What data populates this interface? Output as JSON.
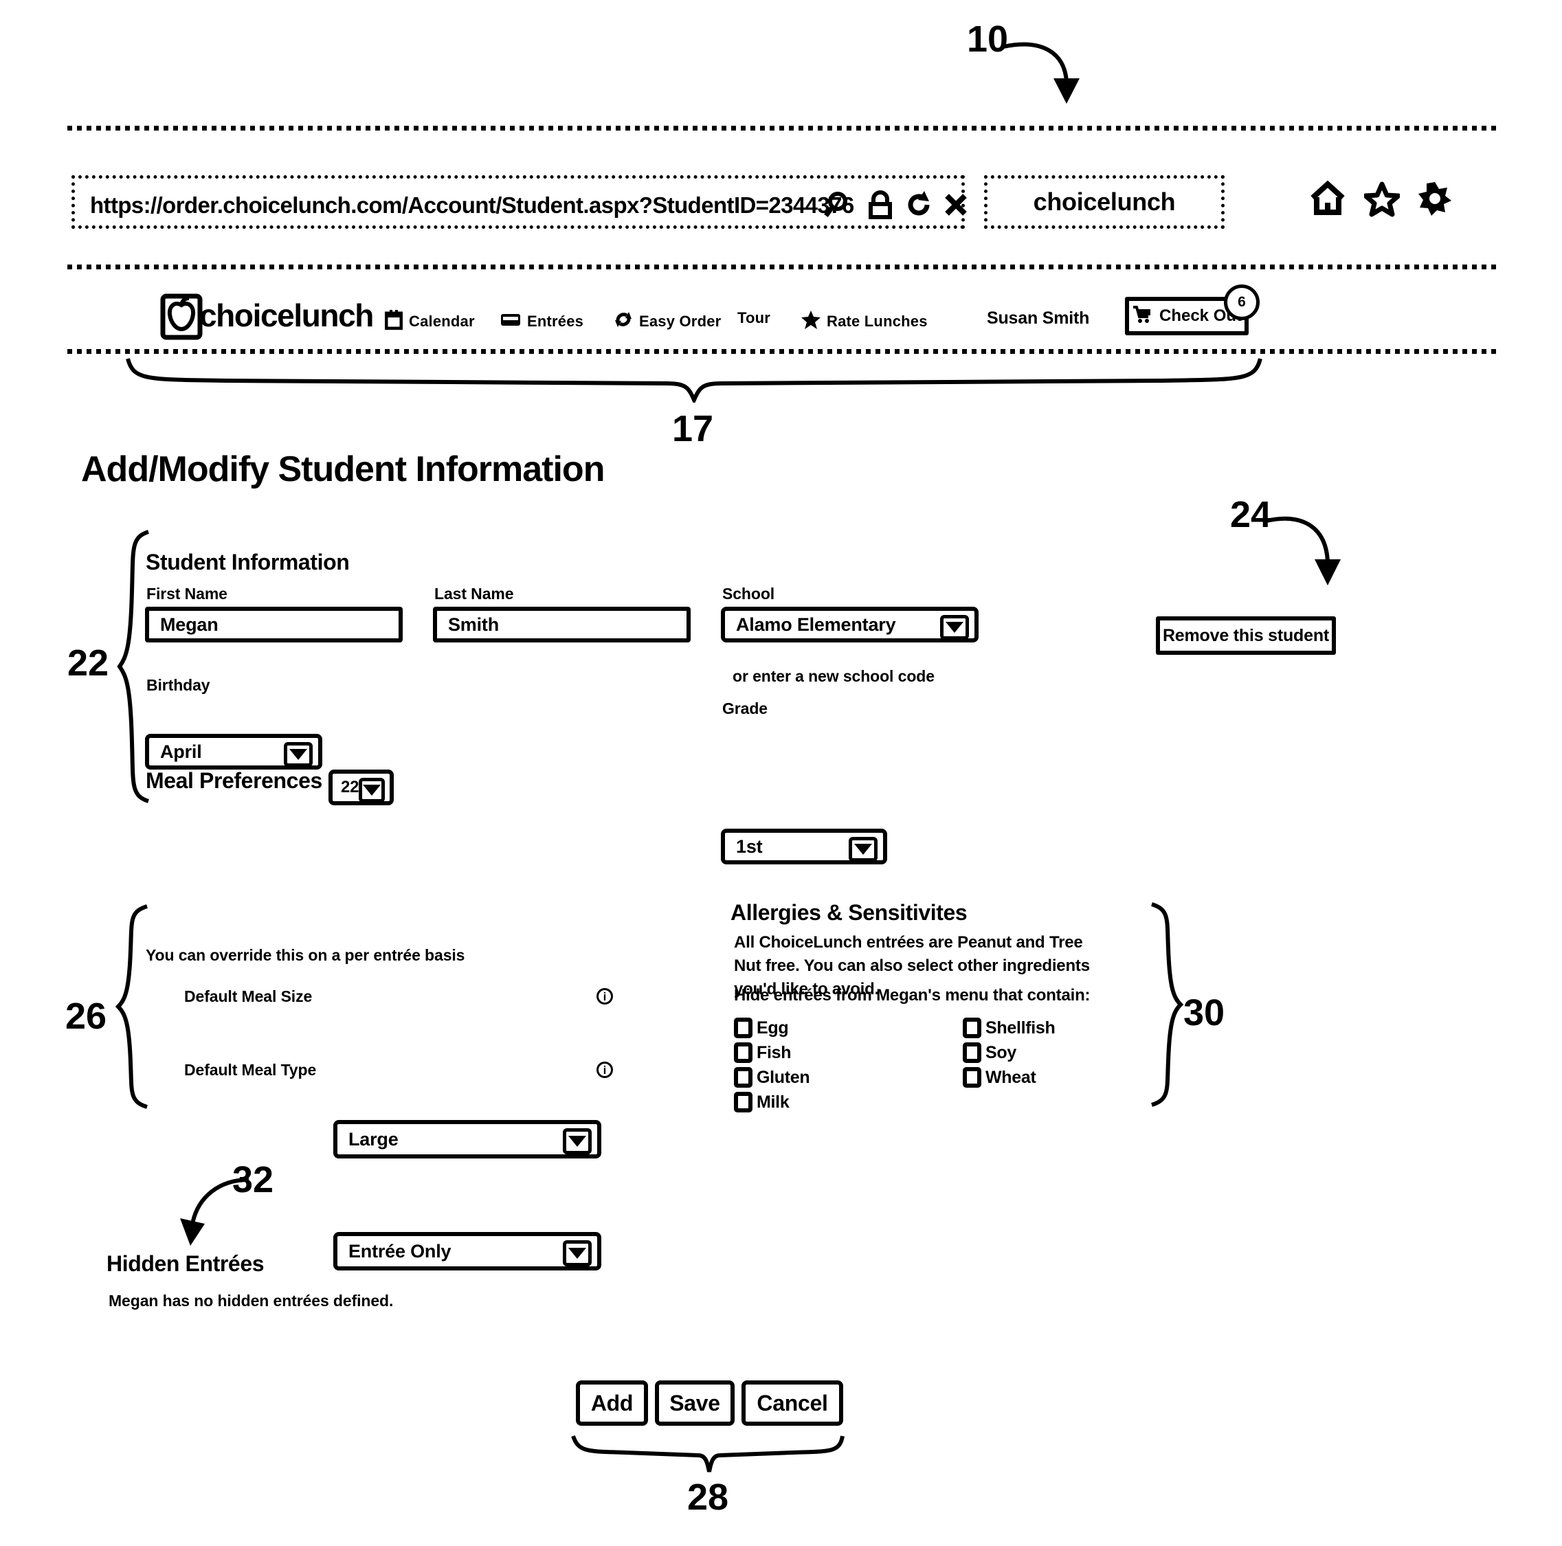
{
  "refs": {
    "browser": "10",
    "navbar": "17",
    "student_info": "22",
    "remove_student": "24",
    "meal_prefs": "26",
    "action_buttons": "28",
    "allergies": "30",
    "hidden_entrees": "32"
  },
  "browser": {
    "url": "https://order.choicelunch.com/Account/Student.aspx?StudentID=2344376",
    "url_icons": [
      "search-icon",
      "lock-icon",
      "refresh-icon",
      "stop-icon"
    ],
    "search_value": "choicelunch",
    "toolbar_icons": [
      "home-icon",
      "favorites-star-icon",
      "settings-gear-icon"
    ]
  },
  "appnav": {
    "brand": "choicelunch",
    "items": [
      {
        "label": "Calendar",
        "icon": "calendar-icon"
      },
      {
        "label": "Entrées",
        "icon": "entree-tray-icon"
      },
      {
        "label": "Easy Order",
        "icon": "refresh-cycle-icon"
      },
      {
        "label": "Tour",
        "icon": ""
      },
      {
        "label": "Rate Lunches",
        "icon": "star-icon"
      }
    ],
    "user": "Susan Smith",
    "checkout_label": "Check Out",
    "checkout_icon": "shopping-cart-icon",
    "cart_count": "6"
  },
  "page": {
    "title": "Add/Modify Student Information"
  },
  "student_info": {
    "heading": "Student Information",
    "first_name_label": "First Name",
    "first_name_value": "Megan",
    "last_name_label": "Last Name",
    "last_name_value": "Smith",
    "school_label": "School",
    "school_value": "Alamo Elementary",
    "school_code_note": "or enter a new school code",
    "birthday_label": "Birthday",
    "birthday_month": "April",
    "birthday_day": "22",
    "grade_label": "Grade",
    "grade_value": "1st",
    "remove_button": "Remove this student"
  },
  "meal_prefs": {
    "heading": "Meal Preferences",
    "subtext": "You can override this on a per entrée basis",
    "size_label": "Default Meal Size",
    "size_value": "Large",
    "type_label": "Default Meal Type",
    "type_value": "Entrée Only",
    "info_icon": "info-icon"
  },
  "allergies": {
    "heading": "Allergies & Sensitivites",
    "description": "All ChoiceLunch entrées are Peanut and Tree Nut free. You can also select other ingredients you'd like to avoid.",
    "hide_label": "Hide entrées from Megan's menu that contain:",
    "left_column": [
      "Egg",
      "Fish",
      "Gluten",
      "Milk"
    ],
    "right_column": [
      "Shellfish",
      "Soy",
      "Wheat"
    ]
  },
  "hidden_entrees": {
    "heading": "Hidden Entrées",
    "message": "Megan has no hidden entrées defined."
  },
  "actions": {
    "add": "Add",
    "save": "Save",
    "cancel": "Cancel"
  }
}
